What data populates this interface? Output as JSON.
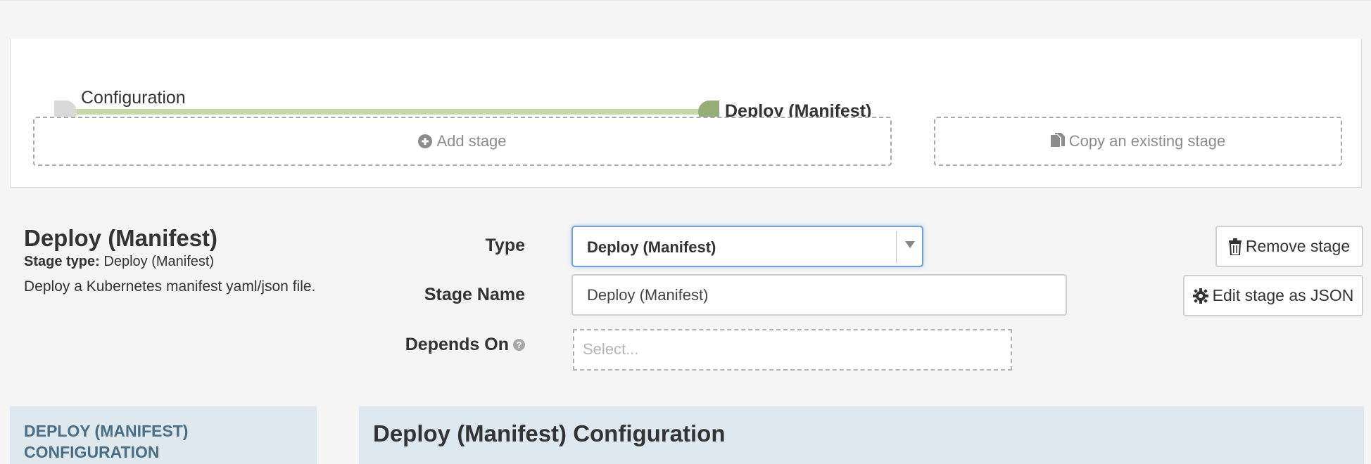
{
  "pipeline_graph": {
    "nodes": [
      {
        "label": "Configuration",
        "color": "#d9d9d9"
      },
      {
        "label": "Deploy (Manifest)",
        "color": "#95ad76"
      }
    ],
    "connector_color": "#c8d9a9",
    "add_stage_label": "Add stage",
    "copy_stage_label": "Copy an existing stage"
  },
  "stage_info": {
    "title": "Deploy (Manifest)",
    "type_prefix": "Stage type:",
    "type_value": "Deploy (Manifest)",
    "description": "Deploy a Kubernetes manifest yaml/json file."
  },
  "form": {
    "type_label": "Type",
    "type_selected": "Deploy (Manifest)",
    "stage_name_label": "Stage Name",
    "stage_name_value": "Deploy (Manifest)",
    "depends_on_label": "Depends On",
    "depends_on_placeholder": "Select..."
  },
  "actions": {
    "remove_stage_label": "Remove stage",
    "edit_json_label": "Edit stage as JSON"
  },
  "sections": {
    "side_nav_item": "DEPLOY (MANIFEST) CONFIGURATION",
    "config_header": "Deploy (Manifest) Configuration"
  },
  "icons": {
    "add": "plus-circle-icon",
    "copy": "copy-icon",
    "trash": "trash-icon",
    "gear": "gear-icon",
    "help": "question-circle-icon",
    "dropdown": "caret-down-icon"
  },
  "colors": {
    "accent_focus": "#6fa1d6",
    "section_bg": "#dde9ef",
    "side_nav_text": "#4b6d83"
  }
}
